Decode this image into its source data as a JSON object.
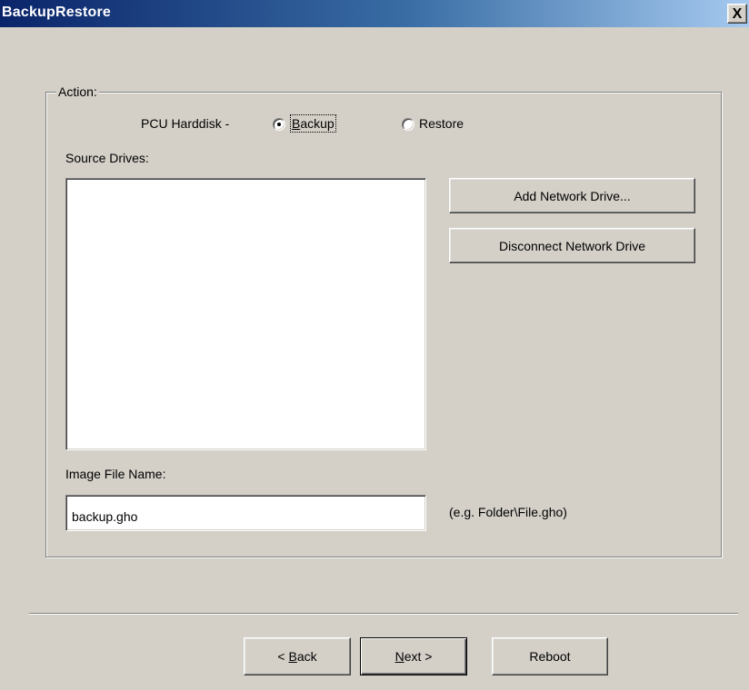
{
  "window": {
    "title": "BackupRestore",
    "close_label": "X"
  },
  "action_group": {
    "label": "Action:",
    "pcu_label": "PCU Harddisk -",
    "radio_backup": {
      "pre": "",
      "mnemonic": "B",
      "post": "ackup",
      "selected": true
    },
    "radio_restore": {
      "pre": "R",
      "mnemonic": "",
      "post": "estore",
      "selected": false
    },
    "source_drives_label": "Source Drives:",
    "source_drives_items": [],
    "add_network_drive": "Add Network Drive...",
    "disconnect_network_drive": "Disconnect Network Drive",
    "image_file_label": "Image File Name:",
    "image_file_value": "backup.gho",
    "image_file_hint": "(e.g. Folder\\File.gho)"
  },
  "footer": {
    "back": {
      "pre": "< ",
      "mnemonic": "B",
      "post": "ack"
    },
    "next": {
      "pre": "",
      "mnemonic": "N",
      "post": "ext >"
    },
    "reboot": "Reboot"
  },
  "colors": {
    "dialog_bg": "#d4d0c8",
    "title_gradient_start": "#0a246a",
    "title_gradient_end": "#a6caf0"
  }
}
